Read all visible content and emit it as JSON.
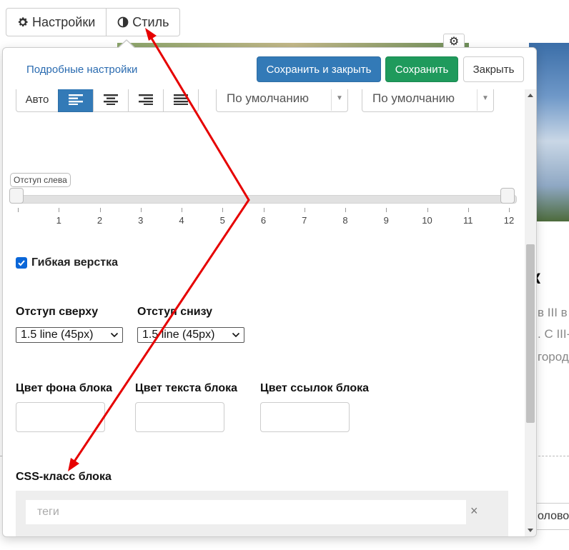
{
  "tabs": {
    "settings": "Настройки",
    "style": "Стиль"
  },
  "header": {
    "advanced_link": "Подробные настройки",
    "save_close": "Сохранить и закрыть",
    "save": "Сохранить",
    "close": "Закрыть"
  },
  "alignment": {
    "auto": "Авто",
    "selected": "left"
  },
  "selects": {
    "font_one": "По умолчанию",
    "font_two": "По умолчанию"
  },
  "slider": {
    "label": "Отступ слева",
    "ticks": [
      "1",
      "2",
      "3",
      "4",
      "5",
      "6",
      "7",
      "8",
      "9",
      "10",
      "11",
      "12"
    ],
    "value": 0
  },
  "flex_layout": {
    "label": "Гибкая верстка",
    "checked": true
  },
  "padding": {
    "top_label": "Отступ сверху",
    "top_value": "1.5 line (45px)",
    "bottom_label": "Отступ снизу",
    "bottom_value": "1.5 line (45px)"
  },
  "colors": {
    "bg_label": "Цвет фона блока",
    "text_label": "Цвет текста блока",
    "link_label": "Цвет ссылок блока"
  },
  "css_class": {
    "label": "CSS-класс блока",
    "placeholder": "теги",
    "clear": "×"
  },
  "background_page": {
    "heading_fragment": "к",
    "line1": "в III в",
    "line2": ". С III-",
    "line3": "город",
    "input_fragment": "оловок"
  },
  "theme": {
    "primary": "#337ab7",
    "success": "#1f9a5c",
    "link": "#2a6bb0",
    "annotation_arrow": "#e60000"
  }
}
